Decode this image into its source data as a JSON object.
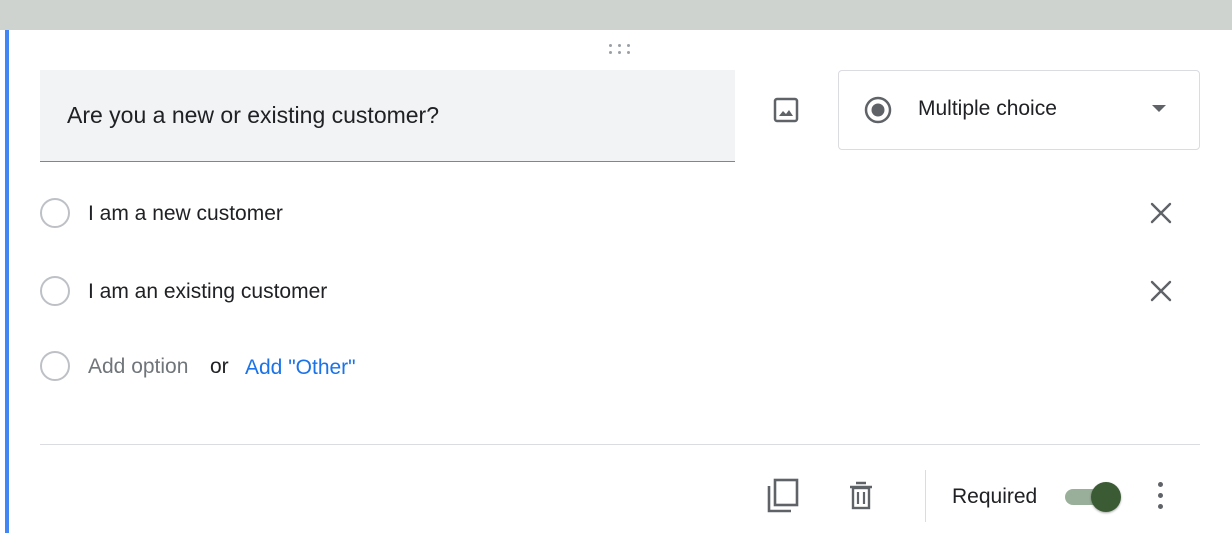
{
  "question": {
    "title": "Are you a new or existing customer?"
  },
  "question_type": {
    "selected": "Multiple choice",
    "icon": "radio-button-checked-icon"
  },
  "options": [
    {
      "label": "I am a new customer"
    },
    {
      "label": "I am an existing customer"
    }
  ],
  "add_option": {
    "placeholder": "Add option",
    "or_text": "or",
    "other_label": "Add \"Other\""
  },
  "footer": {
    "required_label": "Required",
    "required_on": true
  },
  "colors": {
    "accent_bar": "#4285f4",
    "link": "#1a73e8",
    "toggle_on": "#3b5b35"
  }
}
